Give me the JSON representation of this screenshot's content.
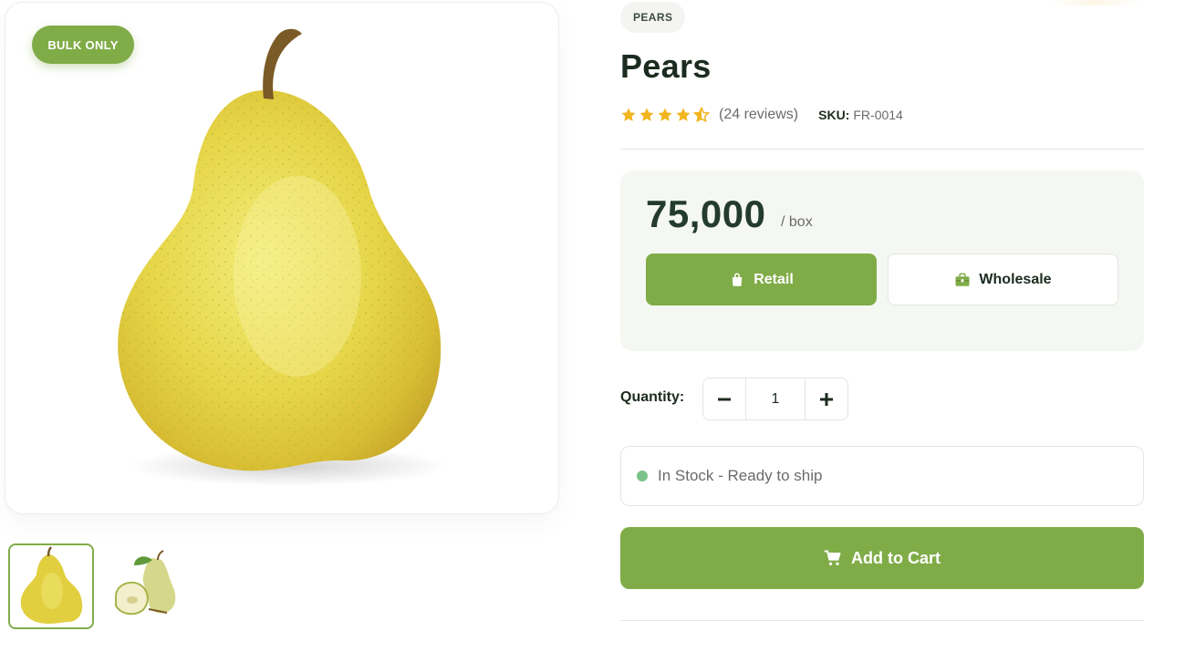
{
  "gallery": {
    "badge": "BULK ONLY",
    "main_image_alt": "pear",
    "thumbnails": [
      {
        "name": "pear-whole"
      },
      {
        "name": "pear-halved"
      }
    ]
  },
  "product": {
    "category": "PEARS",
    "title": "Pears",
    "rating": 4.5,
    "reviews_text": "(24 reviews)",
    "sku_label": "SKU:",
    "sku_value": "FR-0014"
  },
  "pricing": {
    "price": "75,000",
    "unit": "/ box",
    "retail_label": "Retail",
    "wholesale_label": "Wholesale",
    "selected_mode": "Retail"
  },
  "quantity": {
    "label": "Quantity:",
    "value": "1",
    "minus": "−",
    "plus": "+"
  },
  "stock": {
    "text": "In Stock - Ready to ship",
    "dot_color": "#7cc38a"
  },
  "cart": {
    "label": "Add to Cart"
  },
  "colors": {
    "accent": "#80ac48",
    "title": "#1c2b1f",
    "price": "#233b2c",
    "star": "#f2b51f"
  }
}
